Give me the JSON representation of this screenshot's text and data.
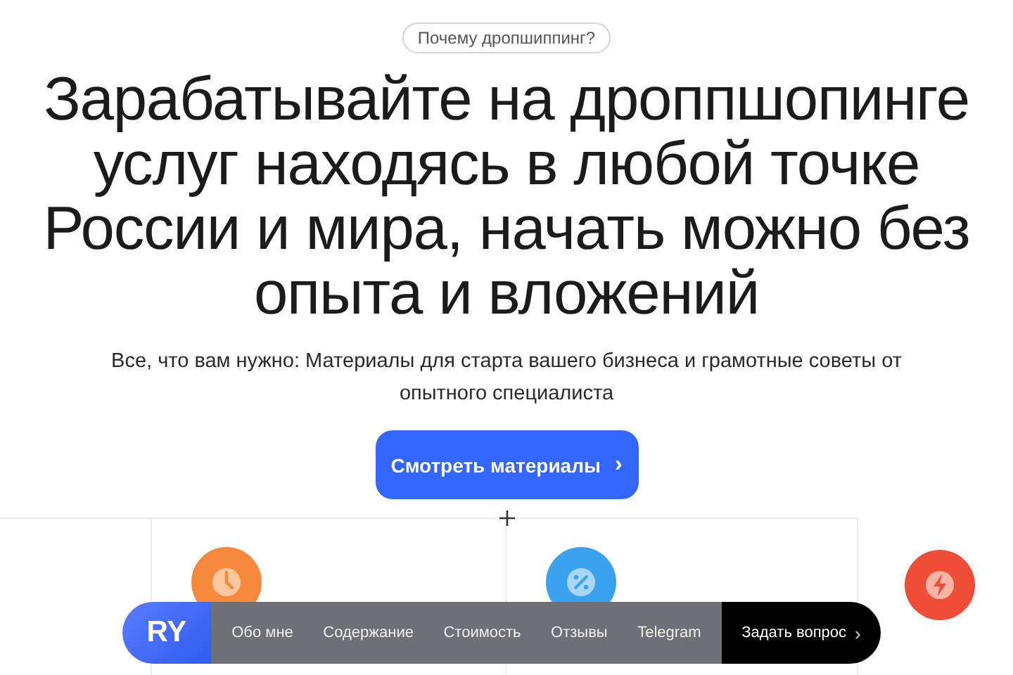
{
  "badge": "Почему дропшиппинг?",
  "headline": "Зарабатывайте на дроппшопинге услуг находясь в любой точке России и мира, начать можно без опыта и вложений",
  "subtitle": "Все, что вам нужно: Материалы для старта вашего бизнеса и грамотные советы от опытного специалиста",
  "cta": {
    "label": "Смотреть материалы",
    "arrow": "›"
  },
  "nav": {
    "logo": "RY",
    "items": [
      "Обо мне",
      "Содержание",
      "Стоимость",
      "Отзывы",
      "Telegram"
    ],
    "action": {
      "label": "Задать вопрос",
      "arrow": "›"
    }
  }
}
